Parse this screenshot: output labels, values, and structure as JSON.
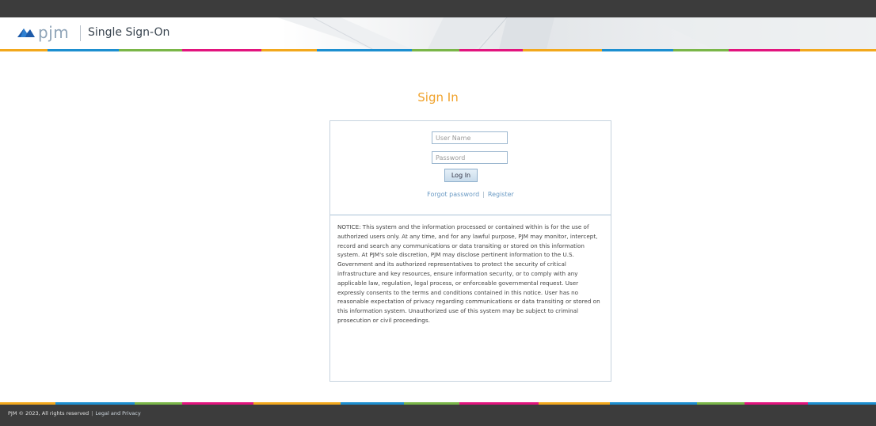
{
  "header": {
    "logo_text": "pjm",
    "app_title": "Single Sign-On"
  },
  "signin": {
    "title": "Sign In",
    "username_placeholder": "User Name",
    "password_placeholder": "Password",
    "login_button": "Log In",
    "forgot_password": "Forgot password",
    "link_separator": "|",
    "register": "Register"
  },
  "notice": "NOTICE: This system and the information processed or contained within is for the use of authorized users only. At any time, and for any lawful purpose, PJM may monitor, intercept, record and search any communications or data transiting or stored on this information system. At PJM's sole discretion, PJM may disclose pertinent information to the U.S. Government and its authorized representatives to protect the security of critical infrastructure and key resources, ensure information security, or to comply with any applicable law, regulation, legal process, or enforceable governmental request. User expressly consents to the terms and conditions contained in this notice. User has no reasonable expectation of privacy regarding communications or data transiting or stored on this information system. Unauthorized use of this system may be subject to criminal prosecution or civil proceedings.",
  "footer": {
    "copyright": "PJM © 2023, All rights reserved",
    "separator": "|",
    "legal_link": "Legal and Privacy"
  },
  "colors": {
    "accent_orange": "#f0a22b",
    "link_blue": "#6a9ac4",
    "dark_bar": "#3c3c3c",
    "stripe": [
      "#f2a81d",
      "#1d8fd0",
      "#7ab648",
      "#e2147e",
      "#f2a81d",
      "#1d8fd0",
      "#7ab648",
      "#e2147e"
    ]
  },
  "icons": {
    "logo": "pjm-logo-icon"
  }
}
